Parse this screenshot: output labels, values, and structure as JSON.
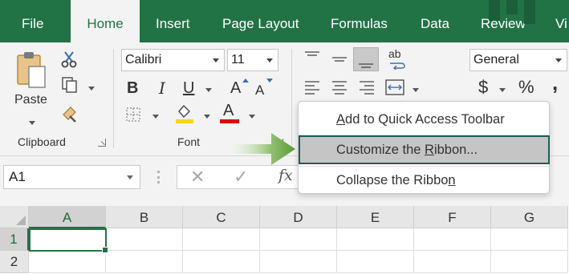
{
  "tabs": [
    {
      "label": "File",
      "active": false
    },
    {
      "label": "Home",
      "active": true
    },
    {
      "label": "Insert",
      "active": false
    },
    {
      "label": "Page Layout",
      "active": false
    },
    {
      "label": "Formulas",
      "active": false
    },
    {
      "label": "Data",
      "active": false
    },
    {
      "label": "Review",
      "active": false
    },
    {
      "label": "Vi",
      "active": false
    }
  ],
  "ribbon": {
    "clipboard": {
      "paste_label": "Paste",
      "group_label": "Clipboard"
    },
    "font": {
      "font_name": "Calibri",
      "font_size": "11",
      "group_label": "Font",
      "bold": "B",
      "italic": "I",
      "underline": "U",
      "grow": "A",
      "shrink": "A",
      "font_color_letter": "A",
      "fill_color": "#ffd700",
      "font_color": "#e00000"
    },
    "alignment": {
      "wrap_label": "ab"
    },
    "number": {
      "format": "General",
      "currency": "$",
      "percent": "%",
      "comma": ","
    }
  },
  "formula_bar": {
    "name_box": "A1",
    "cancel": "✕",
    "enter": "✓",
    "fx": "fx",
    "value": ""
  },
  "grid": {
    "columns": [
      "A",
      "B",
      "C",
      "D",
      "E",
      "F",
      "G"
    ],
    "rows": [
      "1",
      "2"
    ],
    "active_cell": "A1"
  },
  "context_menu": {
    "items": [
      {
        "pre": "",
        "key": "A",
        "post": "dd to Quick Access Toolbar",
        "highlighted": false
      },
      {
        "pre": "Customize the ",
        "key": "R",
        "post": "ibbon...",
        "highlighted": true
      },
      {
        "pre": "Collapse the Ribbo",
        "key": "n",
        "post": "",
        "highlighted": false
      }
    ]
  },
  "colors": {
    "accent": "#217346",
    "arrow": "#6aa84f",
    "highlight_border": "#1f5e55"
  }
}
